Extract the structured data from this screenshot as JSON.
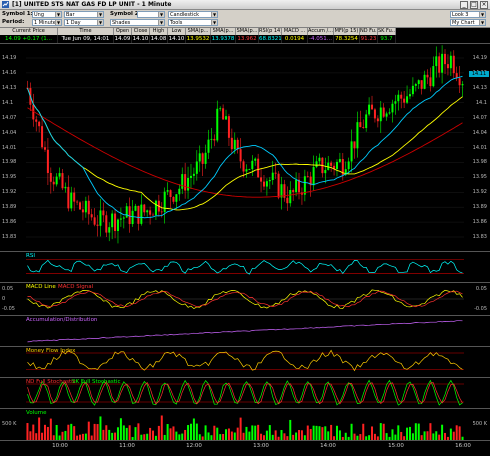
{
  "window": {
    "title": "[1] UNITED STS NAT GAS FD LP   UNIT  - 1 Minute"
  },
  "toolbar": {
    "symbol1_label": "Symbol 1:",
    "symbol1_value": "Ung",
    "period_label": "Period:",
    "period_value": "1 Minute",
    "chart_type": "Bar",
    "days": "1 Day",
    "symbol2_label": "Symbol 2:",
    "symbol2_value": "",
    "style_value": "Candlestick",
    "shades_value": "Shades",
    "tools_value": "Tools",
    "look_value": "Look 3",
    "save_value": "My Chart"
  },
  "stats": {
    "headers": [
      "Current Price",
      "Time",
      "Open",
      "Close",
      "High",
      "Low",
      "SMA(p...",
      "SMA(p...",
      "SMA(p...",
      "RSI(p 14)",
      "MACD ...",
      "Accum /...",
      "MFI(p 15)",
      "ND Fu...",
      "SK Fu..."
    ],
    "values": [
      "14.09 +0.17 (1...",
      "Tue Jun 09, 14:01",
      "14.09",
      "14.10",
      "14.08",
      "14.10",
      "13.9532",
      "13.9378",
      "13.962",
      "68.8321",
      "0.0194",
      "-4.051...",
      "78.3254",
      "91.23",
      "93.7"
    ],
    "colors": [
      "#00ff00",
      "#ffffff",
      "#ffffff",
      "#ffffff",
      "#ffffff",
      "#ffffff",
      "#ffff00",
      "#00ffff",
      "#ff4040",
      "#00ffff",
      "#ffff00",
      "#cc66ff",
      "#ffff00",
      "#ff4040",
      "#00ff00"
    ]
  },
  "price_axis": {
    "ticks": [
      "14.19",
      "14.16",
      "14.13",
      "14.1",
      "14.07",
      "14.04",
      "14.01",
      "13.98",
      "13.95",
      "13.92",
      "13.89",
      "13.86",
      "13.83"
    ],
    "current_tag": "14.11"
  },
  "panels": {
    "rsi": {
      "label": "RSI",
      "color": "#00ffff"
    },
    "macd": {
      "label": "MACD Line",
      "label2": "MACD Signal",
      "ticks": [
        "0.05",
        "0",
        "-0.05"
      ]
    },
    "accum": {
      "label": "Accumulation/Distribution"
    },
    "mfi": {
      "label": "Money Flow Index"
    },
    "stoch": {
      "label": "ND Full Stochastic",
      "label2": "SK Full Stochastic"
    },
    "volume": {
      "label": "Volume",
      "ticks": [
        "500 K",
        "500 K"
      ]
    }
  },
  "time_axis": {
    "labels": [
      "10:00",
      "11:00",
      "12:00",
      "13:00",
      "14:00",
      "15:00",
      "16:00"
    ]
  },
  "colors": {
    "up": "#00ff00",
    "down": "#ff2222",
    "sma1": "#ffff00",
    "sma2": "#00ccff",
    "sma3": "#cc0000"
  }
}
